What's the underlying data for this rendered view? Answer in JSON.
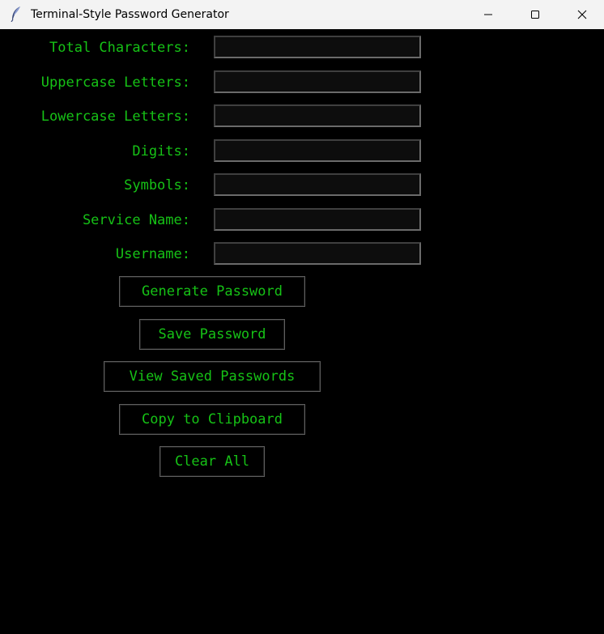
{
  "window": {
    "title": "Terminal-Style Password Generator",
    "icon": "feather-icon",
    "controls": {
      "minimize": "minimize-icon",
      "maximize": "maximize-icon",
      "close": "close-icon"
    }
  },
  "theme": {
    "background": "#000000",
    "foreground": "#16c216",
    "field_background": "#0d0d0d",
    "border": "#5f5f5f"
  },
  "form": {
    "total_characters": {
      "label": "Total Characters:",
      "value": ""
    },
    "uppercase": {
      "label": "Uppercase Letters:",
      "value": ""
    },
    "lowercase": {
      "label": "Lowercase Letters:",
      "value": ""
    },
    "digits": {
      "label": "Digits:",
      "value": ""
    },
    "symbols": {
      "label": "Symbols:",
      "value": ""
    },
    "service_name": {
      "label": "Service Name:",
      "value": ""
    },
    "username": {
      "label": "Username:",
      "value": ""
    }
  },
  "buttons": {
    "generate": "Generate Password",
    "save": "Save Password",
    "view_saved": "View Saved Passwords",
    "copy": "Copy to Clipboard",
    "clear": "Clear All"
  }
}
